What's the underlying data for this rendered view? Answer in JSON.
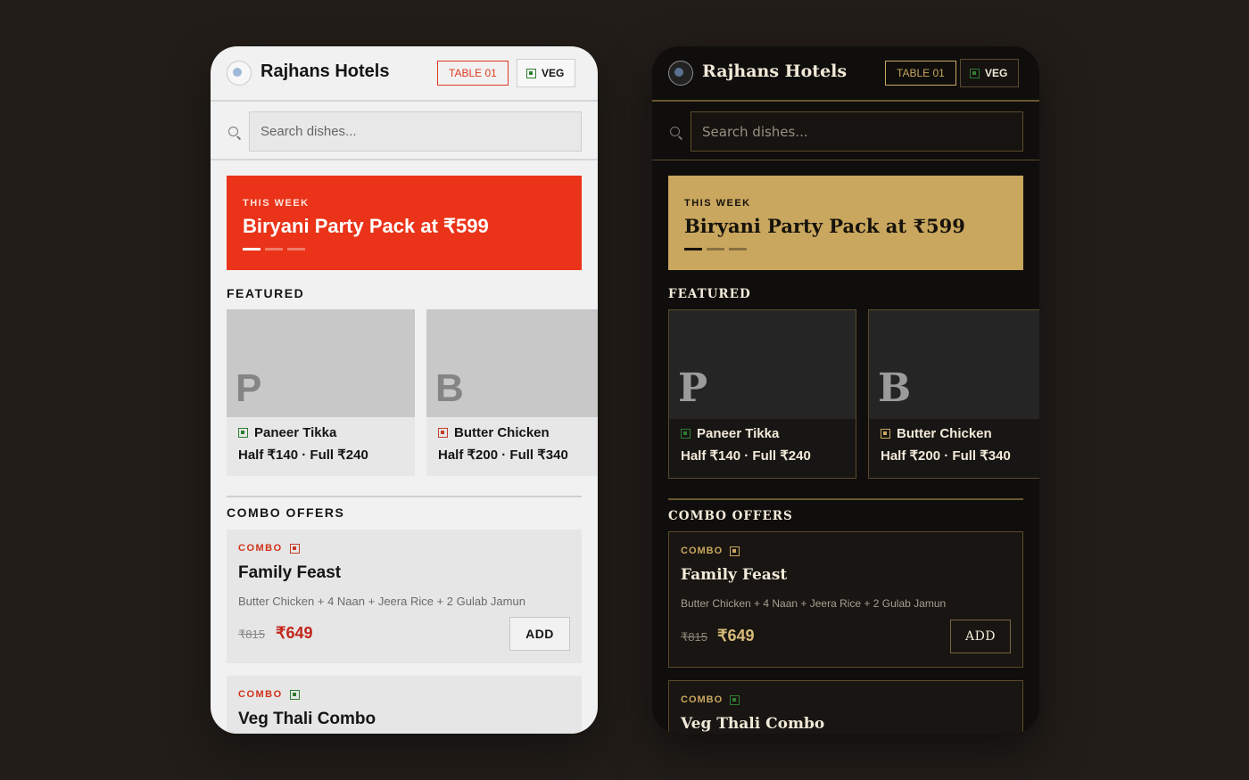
{
  "brand": "Rajhans Hotels",
  "table_label": "TABLE 01",
  "veg_label": "VEG",
  "search_placeholder": "Search dishes...",
  "banner": {
    "kicker": "THIS WEEK",
    "title": "Biryani Party Pack at ₹599",
    "slides": 3,
    "active_slide": 1
  },
  "sections": {
    "featured": "FEATURED",
    "combo": "COMBO OFFERS"
  },
  "featured": [
    {
      "letter": "P",
      "name": "Paneer Tikka",
      "price": "Half ₹140 · Full ₹240",
      "veg": true
    },
    {
      "letter": "B",
      "name": "Butter Chicken",
      "price": "Half ₹200 · Full ₹340",
      "veg": false
    }
  ],
  "combos": [
    {
      "kicker": "COMBO",
      "title": "Family Feast",
      "desc": "Butter Chicken + 4 Naan + Jeera Rice + 2 Gulab Jamun",
      "old_price": "₹815",
      "price": "₹649",
      "add": "ADD",
      "veg": false
    },
    {
      "kicker": "COMBO",
      "title": "Veg Thali Combo",
      "veg": true
    }
  ],
  "themes": {
    "light": {
      "accent": "#ea3318",
      "background": "#f1f1f1"
    },
    "dark": {
      "accent": "#c9a75e",
      "background": "#100e0c"
    }
  }
}
